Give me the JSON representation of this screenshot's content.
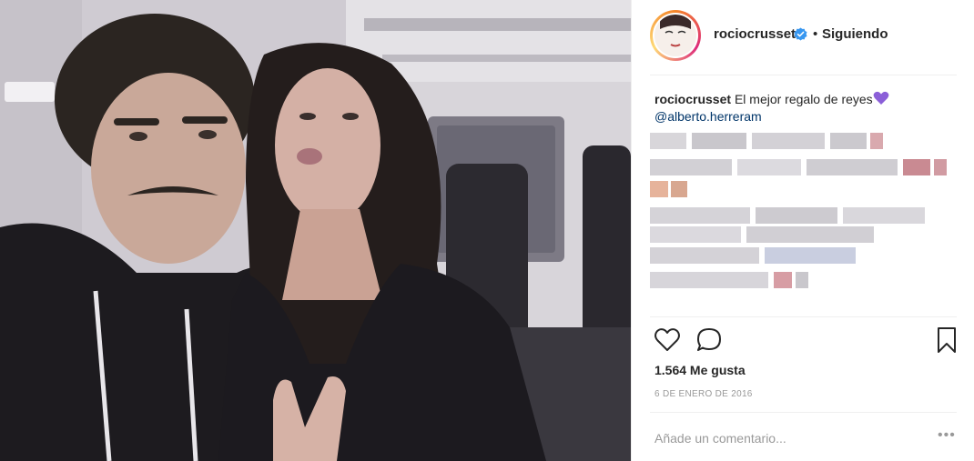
{
  "post": {
    "username": "rociocrusset",
    "separator": "•",
    "follow_status": "Siguiendo",
    "caption_username": "rociocrusset",
    "caption_text": "El mejor regalo de reyes",
    "mention": "@alberto.herreram",
    "likes": "1.564 Me gusta",
    "date": "6 DE ENERO DE 2016"
  },
  "comment_box": {
    "placeholder": "Añade un comentario...",
    "more_label": "•••"
  },
  "icons": {
    "verified": "verified-badge-icon",
    "caption_emoji": "purple-heart-icon",
    "like": "heart-outline-icon",
    "comment": "speech-bubble-icon",
    "save": "bookmark-icon",
    "more": "more-options-icon"
  },
  "colors": {
    "verified_blue": "#3897f0",
    "mention_link": "#003569",
    "purple_heart": "#8b5fd8",
    "muted_text": "#999999"
  }
}
